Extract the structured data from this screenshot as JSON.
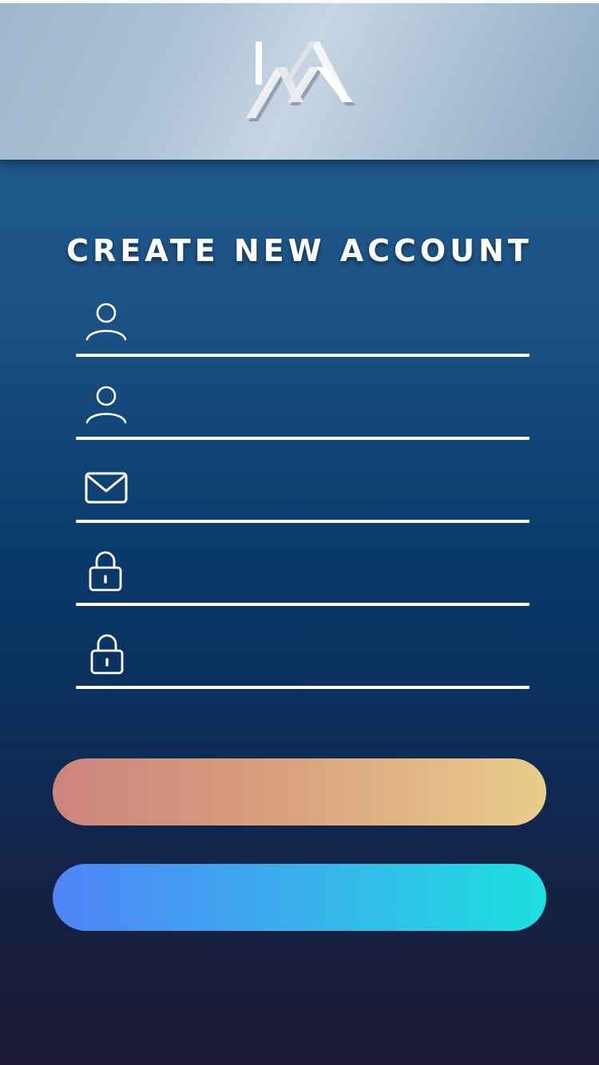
{
  "header": {
    "logo_icon": "jm-monogram-logo"
  },
  "title": "CREATE NEW ACCOUNT",
  "form": {
    "fields": [
      {
        "icon": "user-icon",
        "value": "",
        "placeholder": ""
      },
      {
        "icon": "user-icon",
        "value": "",
        "placeholder": ""
      },
      {
        "icon": "envelope-icon",
        "value": "",
        "placeholder": ""
      },
      {
        "icon": "lock-icon",
        "value": "",
        "placeholder": ""
      },
      {
        "icon": "lock-icon",
        "value": "",
        "placeholder": ""
      }
    ]
  },
  "buttons": {
    "primary_label": "",
    "secondary_label": ""
  },
  "colors": {
    "primary_button_start": "#cc857e",
    "primary_button_end": "#e9cd8c",
    "secondary_button_start": "#4f84f7",
    "secondary_button_end": "#1ce0e0"
  }
}
